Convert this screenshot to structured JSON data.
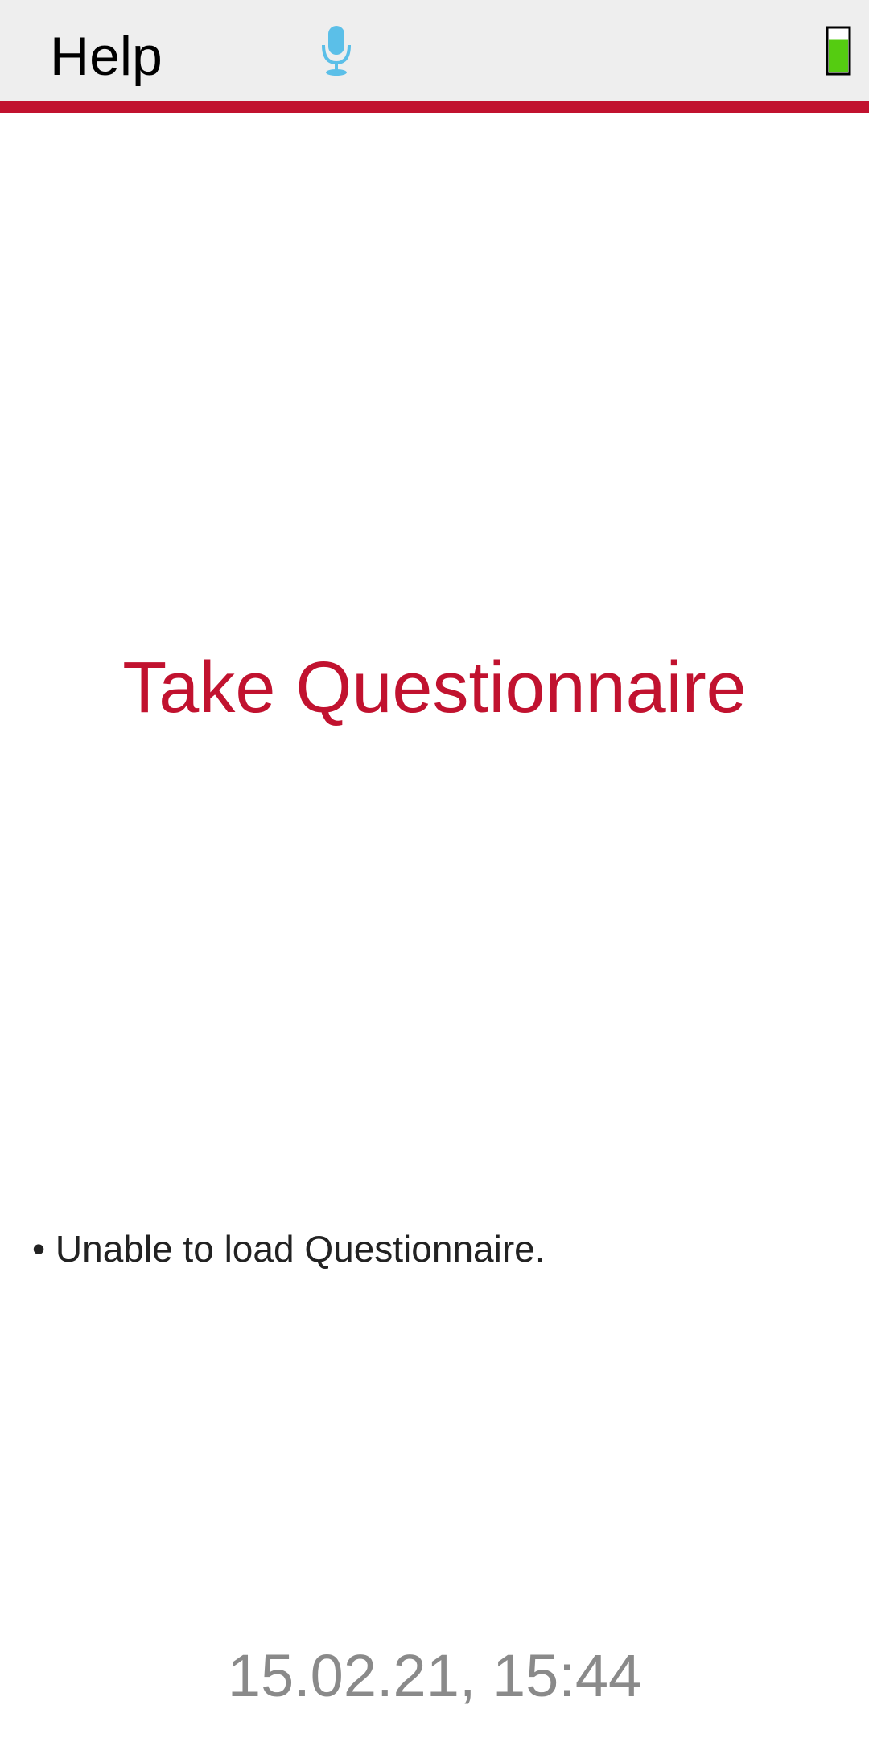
{
  "header": {
    "help_label": "Help",
    "mic_icon": "microphone-icon",
    "battery_icon": "battery-icon",
    "battery_level": 0.75
  },
  "colors": {
    "accent": "#c1122f",
    "header_bg": "#eeeeee",
    "mic": "#5bbfe8",
    "battery_fill": "#55cc11",
    "timestamp": "#8a8a8a"
  },
  "main": {
    "title": "Take Questionnaire",
    "message": "• Unable to load Questionnaire."
  },
  "footer": {
    "timestamp": "15.02.21, 15:44"
  }
}
